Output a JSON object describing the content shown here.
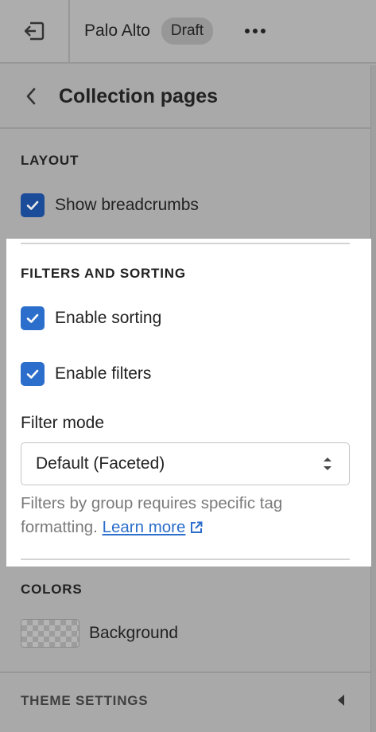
{
  "topbar": {
    "store_name": "Palo Alto",
    "status_badge": "Draft"
  },
  "header": {
    "title": "Collection pages"
  },
  "layout": {
    "heading": "LAYOUT",
    "show_breadcrumbs": {
      "label": "Show breadcrumbs",
      "checked": true
    }
  },
  "filters": {
    "heading": "FILTERS AND SORTING",
    "enable_sorting": {
      "label": "Enable sorting",
      "checked": true
    },
    "enable_filters": {
      "label": "Enable filters",
      "checked": true
    },
    "filter_mode_label": "Filter mode",
    "filter_mode_value": "Default (Faceted)",
    "help_text": "Filters by group requires specific tag formatting.",
    "learn_more": "Learn more"
  },
  "colors": {
    "heading": "COLORS",
    "background_label": "Background"
  },
  "footer": {
    "theme_settings": "THEME SETTINGS"
  },
  "accent_color": "#2c6ecb"
}
